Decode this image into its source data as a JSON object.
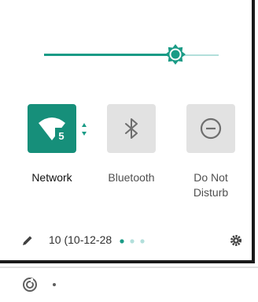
{
  "brightness": {
    "level": 0.75
  },
  "tiles": [
    {
      "label": "Network",
      "icon": "wifi-icon",
      "badge": "5",
      "active": true
    },
    {
      "label": "Bluetooth",
      "icon": "bluetooth-icon",
      "active": false
    },
    {
      "label_line1": "Do Not",
      "label_line2": "Disturb",
      "icon": "do-not-disturb-icon",
      "active": false
    }
  ],
  "footer": {
    "build_text": "10 (10-12-28",
    "page_count": 3,
    "current_page": 1
  },
  "notification_strip": {
    "icon": "data-saver-icon"
  },
  "colors": {
    "accent": "#1a9b86",
    "accent_light": "#b2dfdb",
    "tile_inactive": "#e2e2e2"
  }
}
